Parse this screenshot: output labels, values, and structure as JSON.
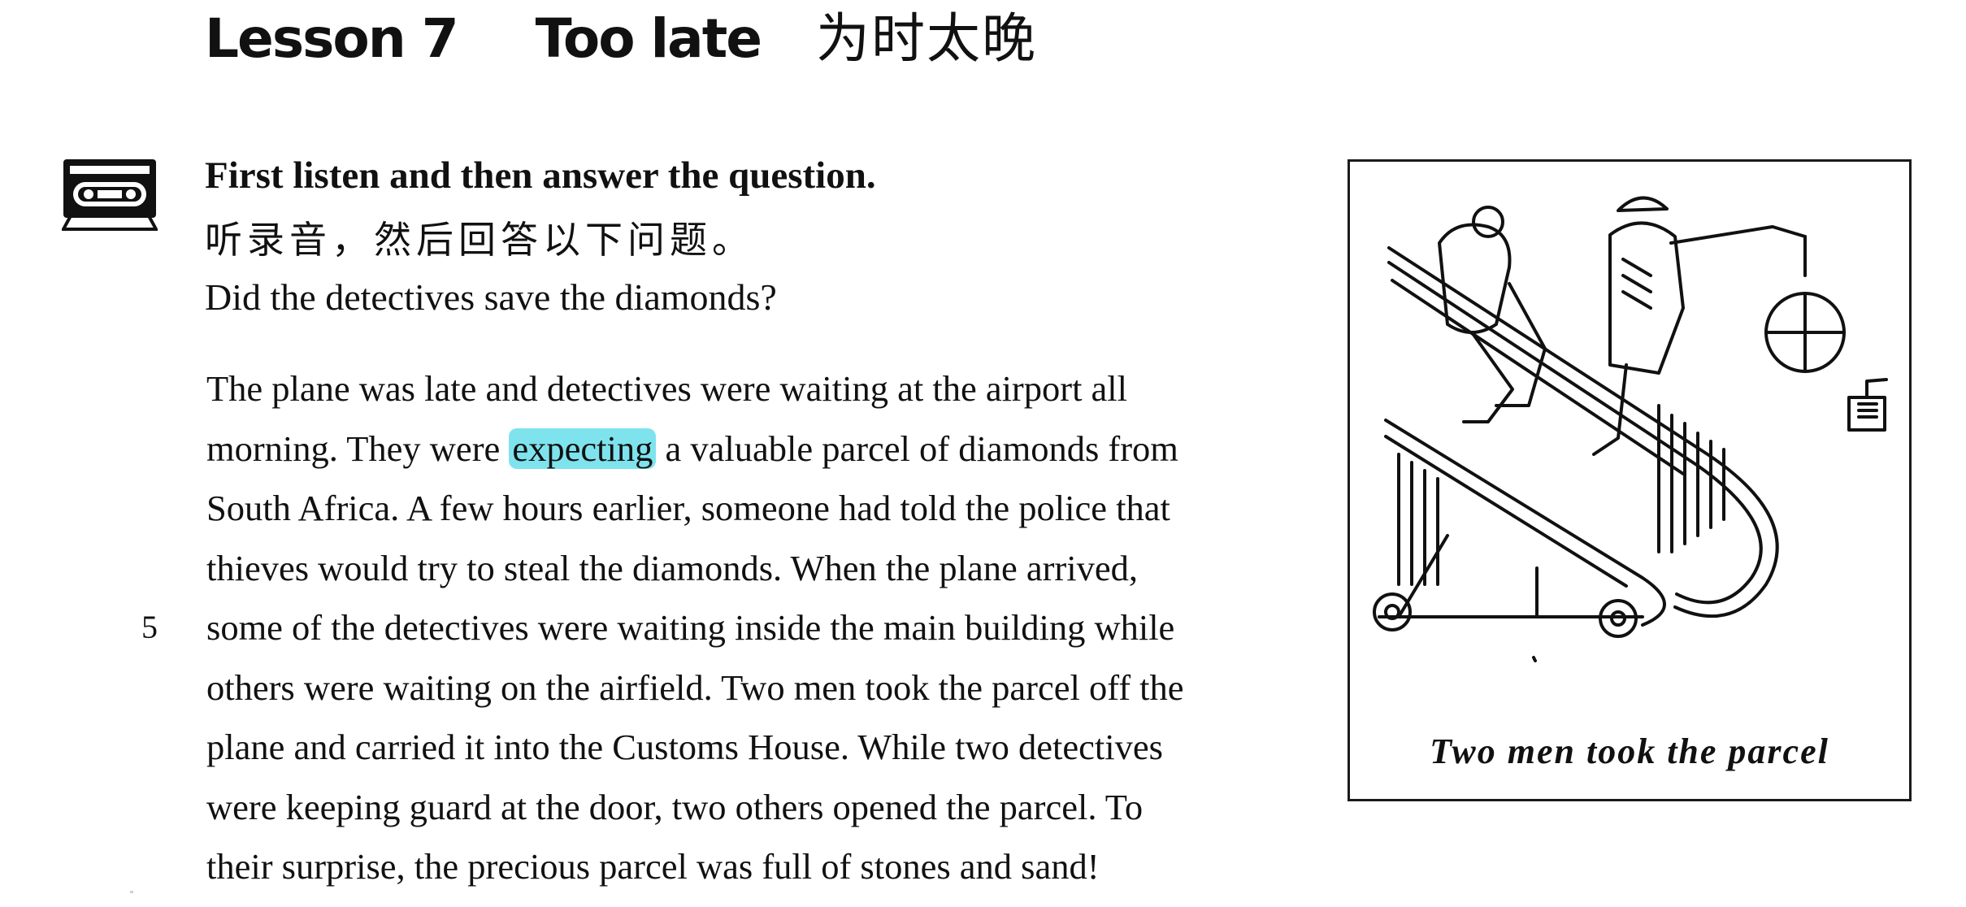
{
  "header": {
    "lesson": "Lesson 7",
    "title_en": "Too late",
    "title_cn": "为时太晚"
  },
  "icons": {
    "cassette": "cassette-tape-icon"
  },
  "instructions": {
    "heading": "First listen and then answer the question.",
    "heading_cn": "听录音，然后回答以下问题。",
    "question": "Did the detectives save the diamonds?"
  },
  "passage": {
    "line_number": "5",
    "highlighted_word": "expecting",
    "lines": [
      "The plane was late and detectives were waiting at the airport all",
      "morning. They were ",
      " a valuable parcel of diamonds from",
      "South Africa. A few hours earlier, someone had told the police that",
      "thieves would try to steal the diamonds. When the plane arrived,",
      "some of the detectives were waiting inside the main building while",
      "others were waiting on the airfield. Two men took the parcel off the",
      "plane and carried it into the Customs House. While two detectives",
      "were keeping guard at the door, two others opened the parcel. To",
      "their surprise, the precious parcel was full of stones and sand!"
    ]
  },
  "figure": {
    "caption": "Two men took the parcel",
    "illustration": "two men riding an airport escalator carrying a parcel"
  },
  "colors": {
    "highlight": "#7fe3ee",
    "text": "#111111"
  }
}
